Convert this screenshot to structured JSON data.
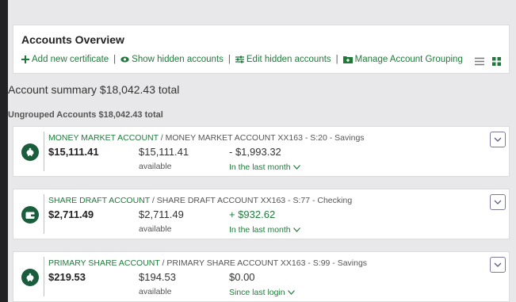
{
  "overview": {
    "title": "Accounts Overview",
    "links": {
      "add": "Add new certificate",
      "show_hidden": "Show hidden accounts",
      "edit_hidden": "Edit hidden accounts",
      "manage": "Manage Account Grouping"
    }
  },
  "summary": "Account summary $18,042.43 total",
  "ungrouped": "Ungrouped Accounts  $18,042.43 total",
  "accounts": [
    {
      "icon": "piggy-bank-icon",
      "name": "MONEY MARKET ACCOUNT",
      "detail": " / MONEY MARKET ACCOUNT XX163 - S:20 - Savings",
      "balance": "$15,111.41",
      "available": "$15,111.41",
      "available_label": "available",
      "change": "- $1,993.32",
      "change_positive": false,
      "period": "In the last month"
    },
    {
      "icon": "wallet-icon",
      "name": "SHARE DRAFT ACCOUNT",
      "detail": " / SHARE DRAFT ACCOUNT XX163 - S:77 - Checking",
      "balance": "$2,711.49",
      "available": "$2,711.49",
      "available_label": "available",
      "change": "+ $932.62",
      "change_positive": true,
      "period": "In the last month"
    },
    {
      "icon": "piggy-bank-icon",
      "name": "PRIMARY SHARE ACCOUNT",
      "detail": " / PRIMARY SHARE ACCOUNT XX163 - S:99 - Savings",
      "balance": "$219.53",
      "available": "$194.53",
      "available_label": "available",
      "change": "$0.00",
      "change_positive": false,
      "period": "Since last login"
    }
  ],
  "colors": {
    "accent": "#1f7a3a",
    "badge": "#1a5d3c"
  }
}
